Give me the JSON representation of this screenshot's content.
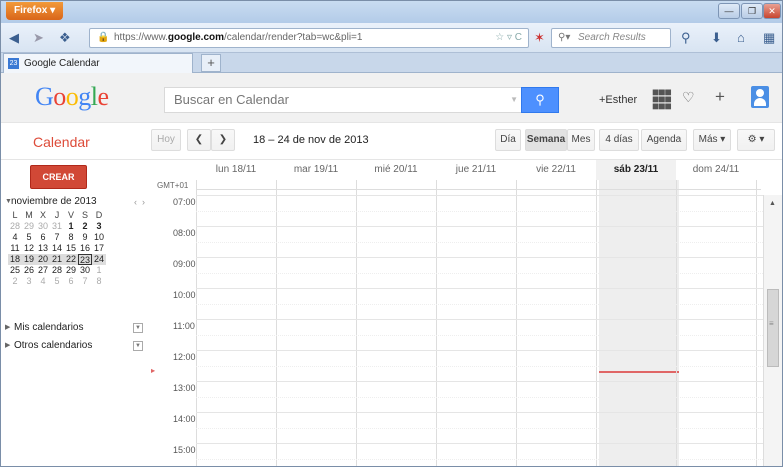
{
  "browser": {
    "menu_label": "Firefox ▾",
    "url_prefix": "https://www.",
    "url_domain": "google.com",
    "url_path": "/calendar/render?tab=wc&pli=1",
    "search_placeholder": "Search Results",
    "tab_title": "Google Calendar",
    "tab_favicon_text": "23"
  },
  "header": {
    "logo": "Google",
    "logo_colors": [
      "#4285f4",
      "#ea4335",
      "#fbbc05",
      "#4285f4",
      "#34a853",
      "#ea4335"
    ],
    "search_placeholder": "Buscar en Calendar",
    "user_label": "+Esther"
  },
  "toolbar": {
    "app_name": "Calendar",
    "today_label": "Hoy",
    "date_range": "18 – 24 de nov de 2013",
    "views": [
      "Día",
      "Semana",
      "Mes",
      "4 días",
      "Agenda"
    ],
    "more_label": "Más ▾"
  },
  "sidebar": {
    "create_label": "CREAR",
    "mini_month": "noviembre de 2013",
    "weekday_headers": [
      "L",
      "M",
      "X",
      "J",
      "V",
      "S",
      "D"
    ],
    "weeks": [
      [
        "28",
        "29",
        "30",
        "31",
        "1",
        "2",
        "3"
      ],
      [
        "4",
        "5",
        "6",
        "7",
        "8",
        "9",
        "10"
      ],
      [
        "11",
        "12",
        "13",
        "14",
        "15",
        "16",
        "17"
      ],
      [
        "18",
        "19",
        "20",
        "21",
        "22",
        "23",
        "24"
      ],
      [
        "25",
        "26",
        "27",
        "28",
        "29",
        "30",
        "1"
      ],
      [
        "2",
        "3",
        "4",
        "5",
        "6",
        "7",
        "8"
      ]
    ],
    "my_calendars": "Mis calendarios",
    "other_calendars": "Otros calendarios"
  },
  "week": {
    "timezone": "GMT+01",
    "days": [
      "lun 18/11",
      "mar 19/11",
      "mié 20/11",
      "jue 21/11",
      "vie 22/11",
      "sáb 23/11",
      "dom 24/11"
    ],
    "selected_day_index": 5,
    "hours": [
      "07:00",
      "08:00",
      "09:00",
      "10:00",
      "11:00",
      "12:00",
      "13:00",
      "14:00",
      "15:00"
    ]
  },
  "colors": {
    "accent_red": "#dd4b39",
    "create_button": "#d14836",
    "search_blue": "#4d90fe",
    "now_line": "#e06666"
  }
}
